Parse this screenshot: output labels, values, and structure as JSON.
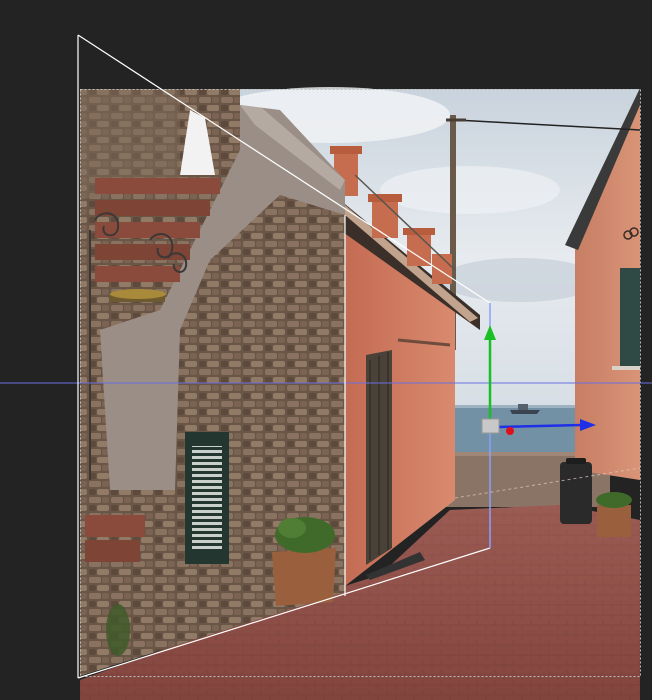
{
  "app": {
    "mode": "perspective-3d-guides",
    "background_color": "#232323"
  },
  "image": {
    "subject": "alley-street-scene",
    "photo_colors": {
      "sky": "#d9dfe6",
      "sea": "#6e8ea4",
      "stone": "#6b5a4a",
      "plaster_orange": "#c9745c",
      "plaster_grey": "#9b8f86",
      "brick_floor": "#8e4f44",
      "shutter_green": "#2f4a44"
    }
  },
  "overlay": {
    "frustum_color": "#ffffff",
    "horizon_color": "#6a6fe0",
    "gizmo": {
      "x_axis_color": "#1f2fe8",
      "y_axis_color": "#18c024",
      "z_axis_color": "#3a52ff",
      "origin_handle_color": "#c8c8c8",
      "pivot_color": "#e0101a"
    }
  }
}
